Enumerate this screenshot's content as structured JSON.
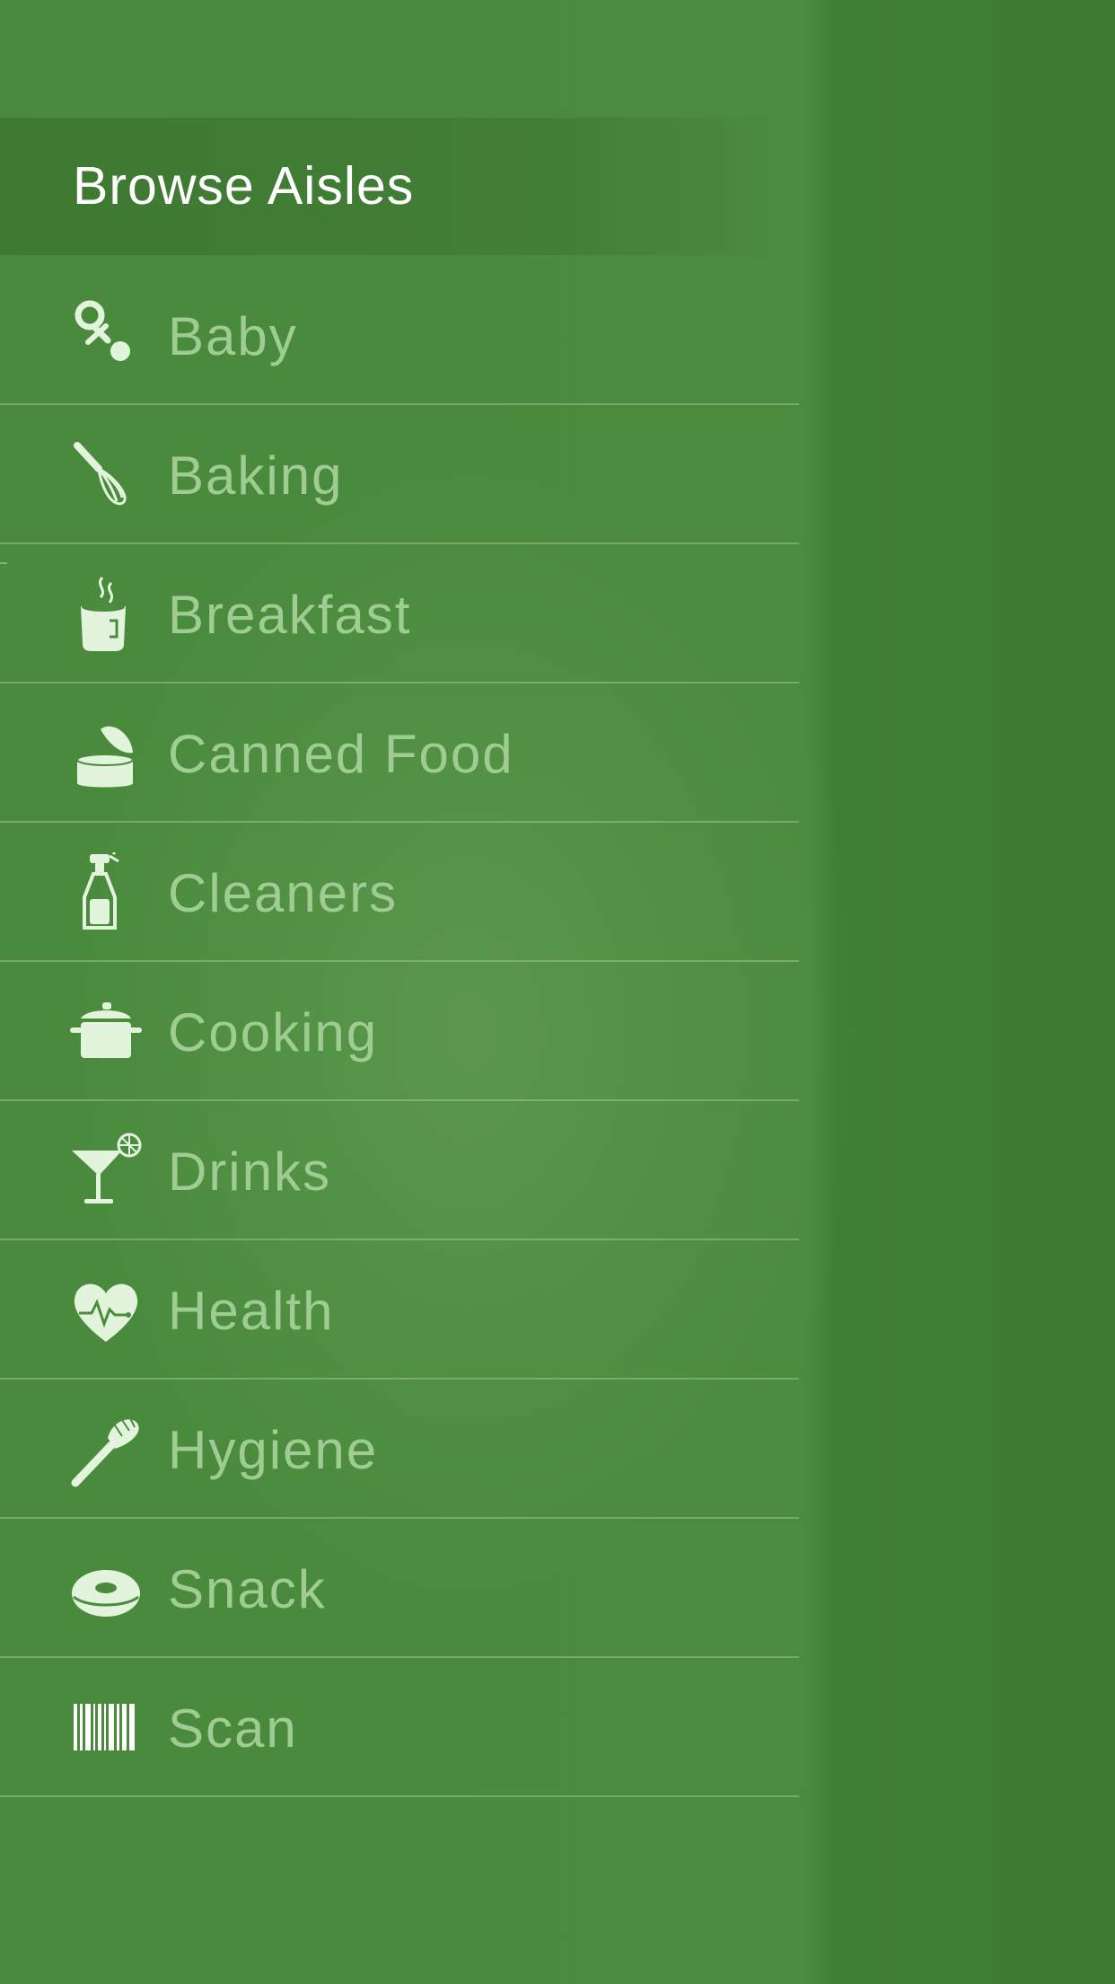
{
  "header": {
    "title": "Browse Aisles"
  },
  "aisles": [
    {
      "label": "Baby",
      "icon": "pacifier-icon"
    },
    {
      "label": "Baking",
      "icon": "whisk-icon"
    },
    {
      "label": "Breakfast",
      "icon": "coffee-cup-icon"
    },
    {
      "label": "Canned Food",
      "icon": "can-icon"
    },
    {
      "label": "Cleaners",
      "icon": "spray-bottle-icon"
    },
    {
      "label": "Cooking",
      "icon": "pot-icon"
    },
    {
      "label": "Drinks",
      "icon": "cocktail-icon"
    },
    {
      "label": "Health",
      "icon": "heart-pulse-icon"
    },
    {
      "label": "Hygiene",
      "icon": "toothbrush-icon"
    },
    {
      "label": "Snack",
      "icon": "donut-icon"
    },
    {
      "label": "Scan",
      "icon": "barcode-icon"
    }
  ],
  "colors": {
    "background": "#3f7f32",
    "panel": "#4b8b3e",
    "label": "#9fcc93",
    "icon": "#e2f5dc",
    "title": "#ffffff"
  }
}
